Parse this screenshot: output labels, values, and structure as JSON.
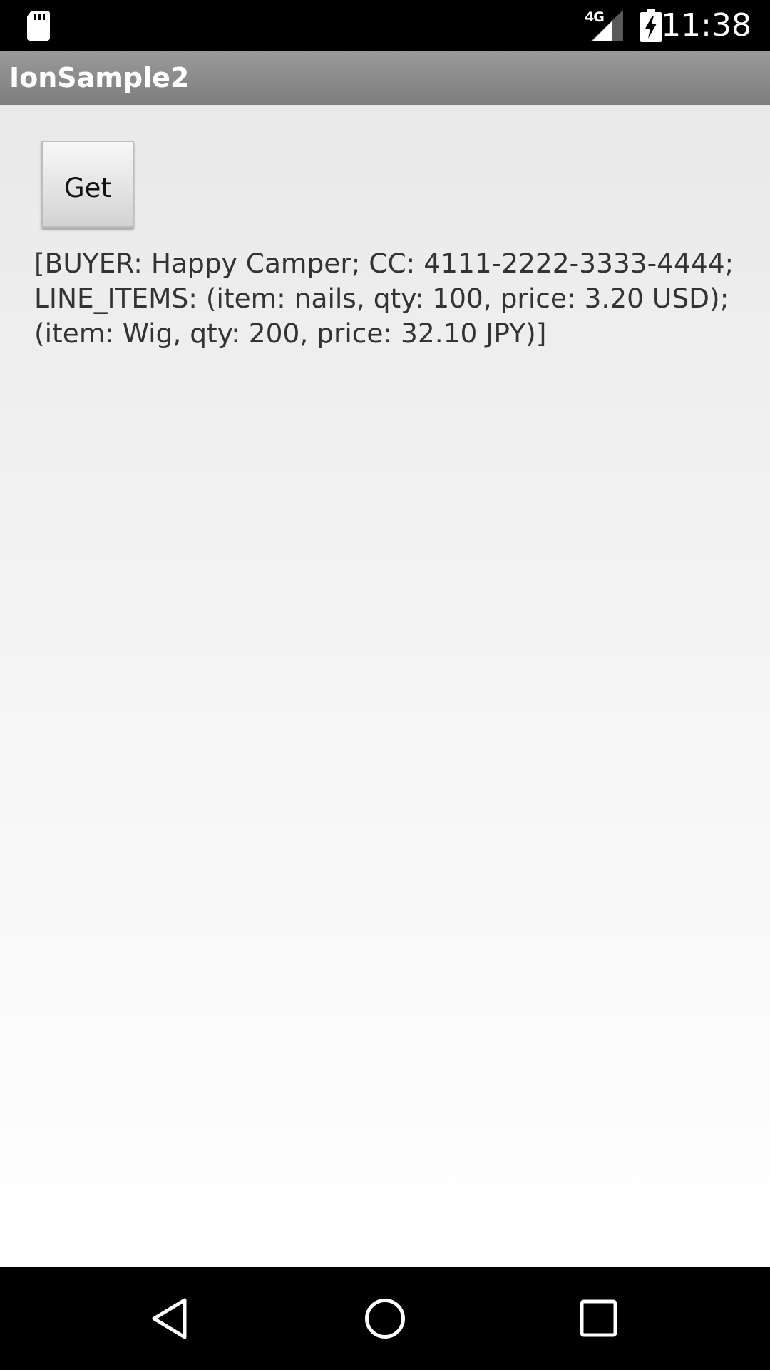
{
  "status_bar": {
    "network_label": "4G",
    "time": "11:38",
    "icons": [
      "sd-card-icon",
      "cellular-signal-icon",
      "battery-charging-icon"
    ]
  },
  "action_bar": {
    "title": "IonSample2"
  },
  "main": {
    "get_button_label": "Get",
    "result_text": "[BUYER: Happy Camper; CC: 4111-2222-3333-4444;\nLINE_ITEMS: (item: nails, qty: 100, price: 3.20 USD);\n(item: Wig, qty: 200, price: 32.10 JPY)]"
  },
  "nav_bar": {
    "icons": [
      "back-icon",
      "home-icon",
      "recents-icon"
    ]
  },
  "colors": {
    "status_bar_bg": "#000000",
    "action_bar_bg": "#8c8c8c",
    "content_bg_top": "#e9e9e9",
    "content_bg_bottom": "#ffffff",
    "text": "#333333",
    "nav_bar_bg": "#000000"
  }
}
